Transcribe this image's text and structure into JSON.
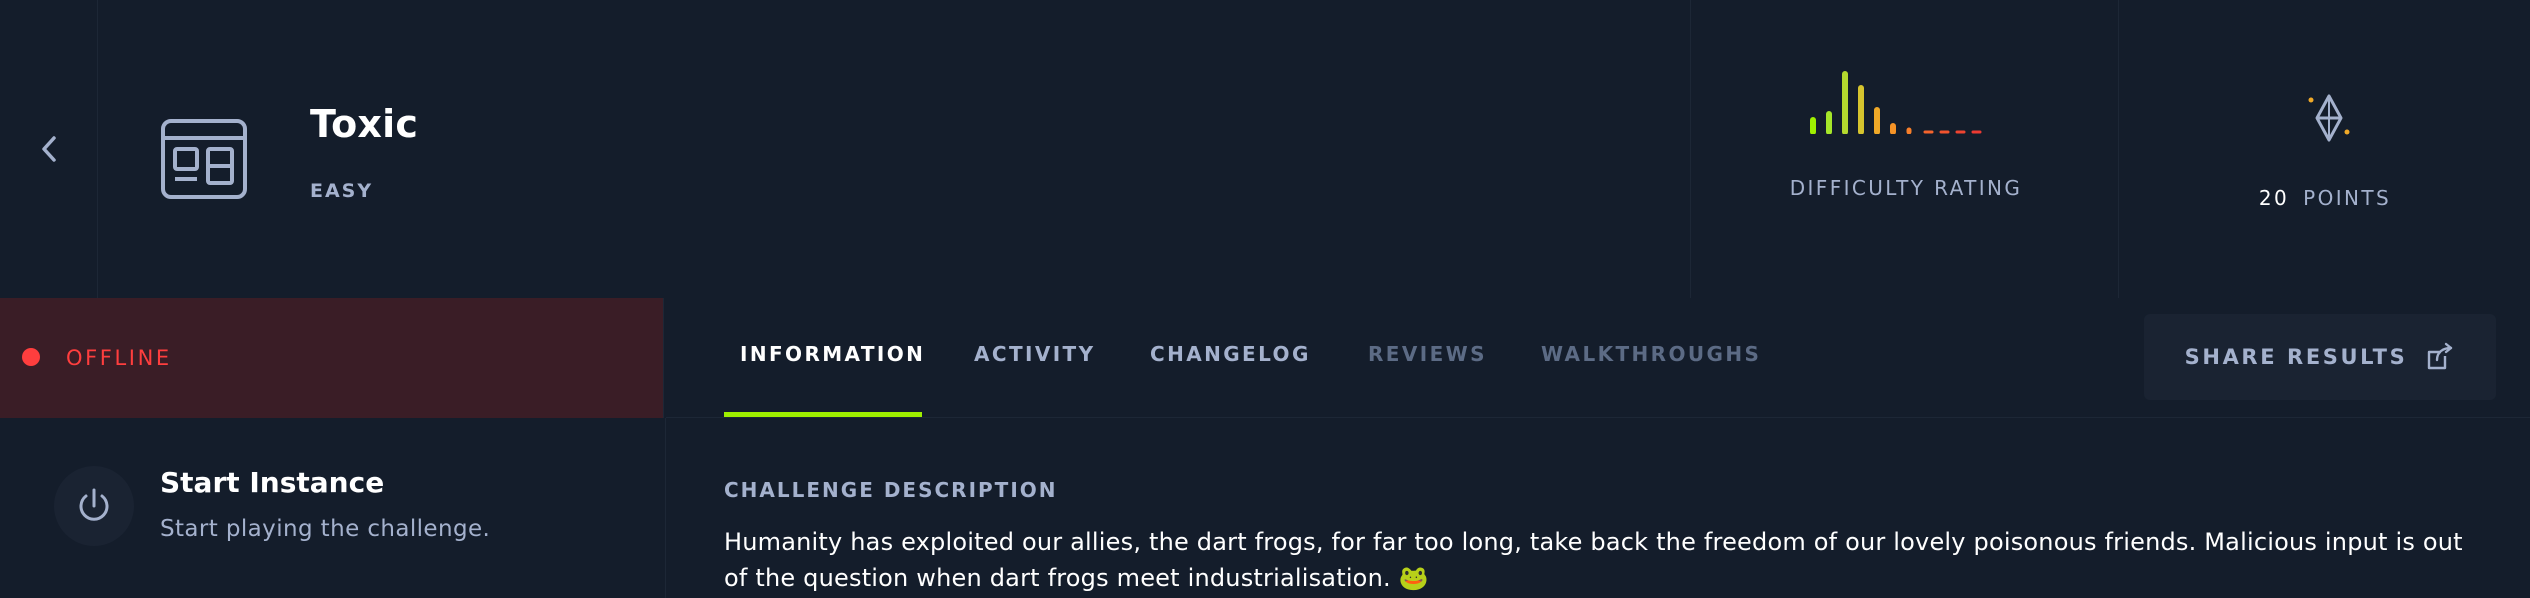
{
  "challenge": {
    "title": "Toxic",
    "difficulty": "EASY",
    "difficulty_rating_label": "DIFFICULTY RATING",
    "points_value": "20",
    "points_label": "POINTS",
    "category_icon": "web-window-icon",
    "points_icon": "diamond-icon"
  },
  "status": {
    "text": "OFFLINE",
    "color": "#ff3e3e"
  },
  "start_instance": {
    "title": "Start Instance",
    "subtitle": "Start playing the challenge."
  },
  "tabs": [
    {
      "label": "INFORMATION",
      "state": "active"
    },
    {
      "label": "ACTIVITY",
      "state": "normal"
    },
    {
      "label": "CHANGELOG",
      "state": "normal"
    },
    {
      "label": "REVIEWS",
      "state": "muted"
    },
    {
      "label": "WALKTHROUGHS",
      "state": "muted"
    }
  ],
  "share": {
    "label": "SHARE RESULTS"
  },
  "description": {
    "heading": "CHALLENGE DESCRIPTION",
    "text": "Humanity has exploited our allies, the dart frogs, for far too long, take back the freedom of our lovely poisonous friends. Malicious input is out of the question when dart frogs meet industrialisation. 🐸"
  },
  "colors": {
    "background": "#141d2b",
    "accent": "#9fef00",
    "offline_bg": "#3a1d26",
    "muted_text": "#a4b1cd"
  }
}
